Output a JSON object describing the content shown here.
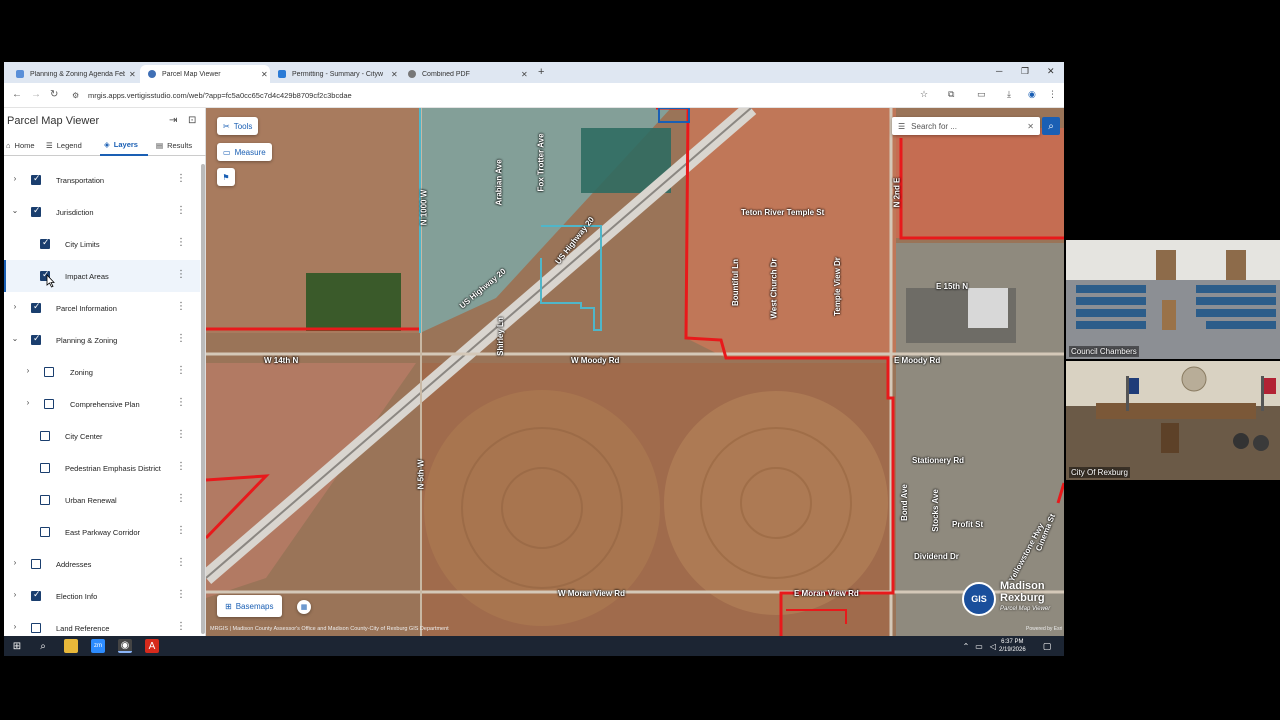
{
  "browser": {
    "tabs": [
      {
        "label": "Planning & Zoning Agenda Feb",
        "active": false
      },
      {
        "label": "Parcel Map Viewer",
        "active": true
      },
      {
        "label": "Permitting - Summary - Cityw",
        "active": false
      },
      {
        "label": "Combined PDF",
        "active": false
      }
    ],
    "url": "mrgis.apps.vertigisstudio.com/web/?app=fc5a0cc65c7d4c429b8709cf2c3bcdae"
  },
  "panel": {
    "title": "Parcel Map Viewer",
    "tabs": [
      "Home",
      "Legend",
      "Layers",
      "Results"
    ],
    "active_tab": "Layers",
    "layers": [
      {
        "label": "Transportation",
        "checked": true,
        "expandable": true,
        "expanded": false,
        "indent": 0
      },
      {
        "label": "Jurisdiction",
        "checked": true,
        "expandable": true,
        "expanded": true,
        "indent": 0
      },
      {
        "label": "City Limits",
        "checked": true,
        "expandable": false,
        "indent": 1
      },
      {
        "label": "Impact Areas",
        "checked": true,
        "expandable": false,
        "indent": 1,
        "highlight": true
      },
      {
        "label": "Parcel Information",
        "checked": true,
        "expandable": true,
        "expanded": false,
        "indent": 0
      },
      {
        "label": "Planning & Zoning",
        "checked": true,
        "expandable": true,
        "expanded": true,
        "indent": 0
      },
      {
        "label": "Zoning",
        "checked": false,
        "expandable": true,
        "expanded": false,
        "indent": 1
      },
      {
        "label": "Comprehensive Plan",
        "checked": false,
        "expandable": true,
        "expanded": false,
        "indent": 1
      },
      {
        "label": "City Center",
        "checked": false,
        "expandable": false,
        "indent": 1
      },
      {
        "label": "Pedestrian Emphasis District",
        "checked": false,
        "expandable": false,
        "indent": 1
      },
      {
        "label": "Urban Renewal",
        "checked": false,
        "expandable": false,
        "indent": 1
      },
      {
        "label": "East Parkway Corridor",
        "checked": false,
        "expandable": false,
        "indent": 1
      },
      {
        "label": "Addresses",
        "checked": false,
        "expandable": true,
        "expanded": false,
        "indent": 0
      },
      {
        "label": "Election Info",
        "checked": true,
        "expandable": true,
        "expanded": false,
        "indent": 0
      },
      {
        "label": "Land Reference",
        "checked": false,
        "expandable": true,
        "expanded": false,
        "indent": 0
      }
    ]
  },
  "map": {
    "tools_label": "Tools",
    "measure_label": "Measure",
    "search_placeholder": "Search for ...",
    "basemaps_label": "Basemaps",
    "attribution": "MRGIS | Madison County Assessor's Office and Madison County-City of Rexburg GIS Department",
    "powered_by": "Powered by Esri",
    "logo": {
      "line1": "Madison",
      "line2": "Rexburg",
      "line3": "Parcel Map Viewer",
      "badge": "GIS"
    },
    "street_labels": [
      "N 1000 W",
      "Arabian Ave",
      "Fox Trotter Ave",
      "US Highway 20",
      "US Highway 20",
      "Teton River Temple St",
      "N 2nd E",
      "Bountiful Ln",
      "West Church Dr",
      "Temple View Dr",
      "E 15th N",
      "Shirley Ln",
      "W 14th N",
      "W Moody Rd",
      "E Moody Rd",
      "N 5th W",
      "Stationery Rd",
      "Bond Ave",
      "Stocks Ave",
      "Profit St",
      "Dividend Dr",
      "Yellowstone Hwy",
      "Cinema St",
      "W Moran View Rd",
      "E Moran View Rd"
    ]
  },
  "taskbar": {
    "time": "6:37 PM",
    "date": "2/19/2026"
  },
  "video": [
    {
      "label": "Council Chambers"
    },
    {
      "label": "City Of Rexburg"
    }
  ],
  "colors": {
    "accent": "#1a5fb4",
    "city_limits": "#e8191b",
    "impact_area": "#4fb6c9"
  }
}
